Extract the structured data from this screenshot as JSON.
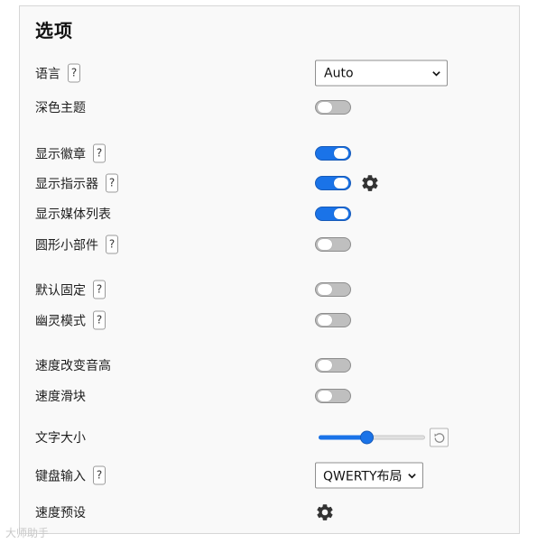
{
  "title": "选项",
  "help_glyph": "?",
  "rows": {
    "language": {
      "label": "语言",
      "value": "Auto"
    },
    "dark_theme": {
      "label": "深色主题",
      "state": "off"
    },
    "show_badge": {
      "label": "显示徽章",
      "state": "on"
    },
    "show_indicator": {
      "label": "显示指示器",
      "state": "on"
    },
    "show_media_list": {
      "label": "显示媒体列表",
      "state": "on"
    },
    "circular_widget": {
      "label": "圆形小部件",
      "state": "off"
    },
    "default_pinned": {
      "label": "默认固定",
      "state": "off"
    },
    "ghost_mode": {
      "label": "幽灵模式",
      "state": "off"
    },
    "speed_changes_pitch": {
      "label": "速度改变音高",
      "state": "off"
    },
    "speed_slider": {
      "label": "速度滑块",
      "state": "off"
    },
    "font_size": {
      "label": "文字大小",
      "slider_fraction": 0.45
    },
    "keyboard_input": {
      "label": "键盘输入",
      "value": "QWERTY布局"
    },
    "speed_presets": {
      "label": "速度预设"
    }
  },
  "watermark": "大师助手",
  "colors": {
    "accent": "#1a73e8",
    "toggle_off": "#bfbfbf",
    "panel_bg": "#f9f9f9"
  },
  "icons": {
    "help": "question-mark-box",
    "settings": "gear",
    "reset": "circular-arrow",
    "dropdown": "chevron-down"
  }
}
